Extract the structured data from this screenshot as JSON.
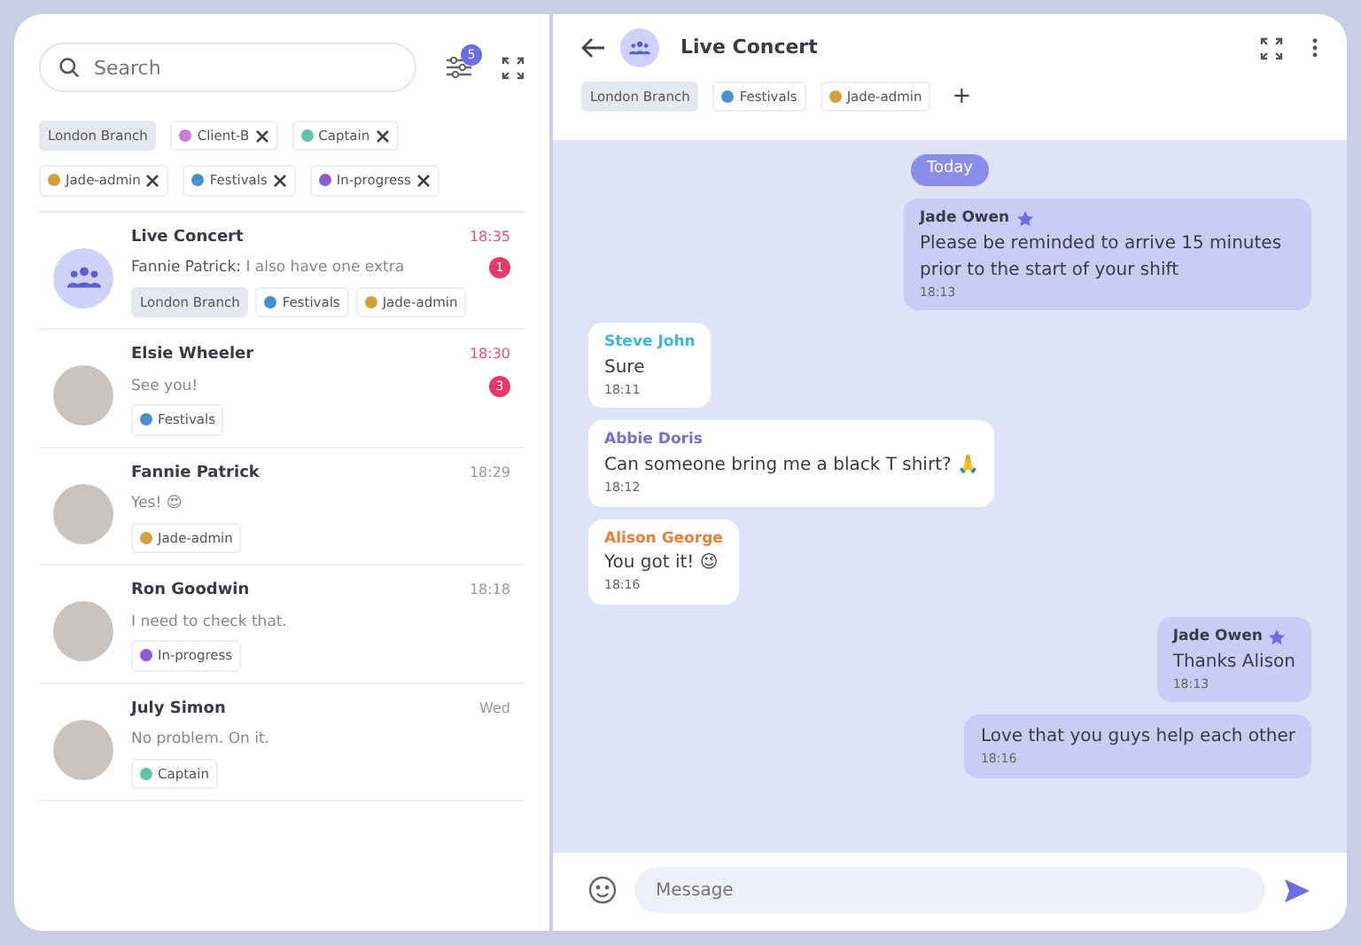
{
  "sidebar": {
    "search": {
      "placeholder": "Search"
    },
    "filter_count": "5",
    "filters": [
      {
        "kind": "group",
        "label": "London Branch",
        "removable": false
      },
      {
        "kind": "label",
        "label": "Client-B",
        "color": "#c77fd6",
        "removable": true
      },
      {
        "kind": "label",
        "label": "Captain",
        "color": "#5fc4a8",
        "removable": true
      },
      {
        "kind": "label",
        "label": "Jade-admin",
        "color": "#d5a03c",
        "removable": true
      },
      {
        "kind": "label",
        "label": "Festivals",
        "color": "#4a8fd0",
        "removable": true
      },
      {
        "kind": "label",
        "label": "In-progress",
        "color": "#8e5bd0",
        "removable": true
      }
    ],
    "chats": [
      {
        "name": "Live Concert",
        "group": true,
        "sender": "Fannie Patrick:",
        "preview": "I also have one extra",
        "time": "18:35",
        "unread": "1",
        "tags": [
          {
            "kind": "group",
            "label": "London Branch"
          },
          {
            "kind": "label",
            "label": "Festivals",
            "color": "#4a8fd0"
          },
          {
            "kind": "label",
            "label": "Jade-admin",
            "color": "#d5a03c"
          }
        ]
      },
      {
        "name": "Elsie Wheeler",
        "group": false,
        "preview": "See you!",
        "time": "18:30",
        "unread": "3",
        "tags": [
          {
            "kind": "label",
            "label": "Festivals",
            "color": "#4a8fd0"
          }
        ]
      },
      {
        "name": "Fannie Patrick",
        "group": false,
        "preview": "Yes! 😍",
        "time": "18:29",
        "tags": [
          {
            "kind": "label",
            "label": "Jade-admin",
            "color": "#d5a03c"
          }
        ]
      },
      {
        "name": "Ron Goodwin",
        "group": false,
        "preview": "I need to check that.",
        "time": "18:18",
        "tags": [
          {
            "kind": "label",
            "label": "In-progress",
            "color": "#8e5bd0"
          }
        ]
      },
      {
        "name": "July Simon",
        "group": false,
        "preview": "No problem. On it.",
        "time": "Wed",
        "tags": [
          {
            "kind": "label",
            "label": "Captain",
            "color": "#5fc4a8"
          }
        ]
      }
    ]
  },
  "conversation": {
    "title": "Live Concert",
    "tags": [
      {
        "kind": "group",
        "label": "London Branch"
      },
      {
        "kind": "label",
        "label": "Festivals",
        "color": "#4a8fd0"
      },
      {
        "kind": "label",
        "label": "Jade-admin",
        "color": "#d5a03c"
      }
    ],
    "add_tag": "+",
    "date_divider": "Today",
    "messages": [
      {
        "kind": "outgoing",
        "sender": "Jade Owen",
        "starred": true,
        "text": "Please be reminded to arrive 15 minutes prior to the start of your shift",
        "time": "18:13"
      },
      {
        "kind": "incoming",
        "sender": "Steve John",
        "color": "#3fb6dc",
        "text": "Sure",
        "time": "18:11"
      },
      {
        "kind": "incoming",
        "sender": "Abbie Doris",
        "color": "#7a6fd0",
        "text": "Can someone bring me a black T shirt? 🙏",
        "time": "18:12"
      },
      {
        "kind": "incoming",
        "sender": "Alison George",
        "color": "#e8803a",
        "text": "You got it! 😉",
        "time": "18:16"
      },
      {
        "kind": "outgoing",
        "sender": "Jade Owen",
        "starred": true,
        "text": "Thanks Alison",
        "time": "18:13"
      },
      {
        "kind": "outgoing",
        "text": "Love that you guys help each other",
        "time": "18:16"
      }
    ],
    "composer": {
      "placeholder": "Message"
    }
  }
}
